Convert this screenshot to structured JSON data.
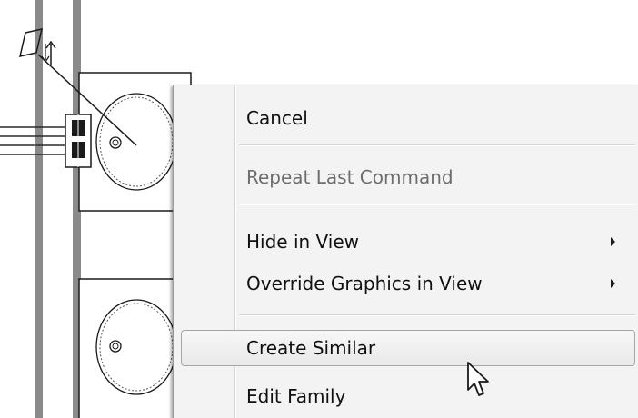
{
  "context_menu": {
    "items": [
      {
        "label": "Cancel",
        "enabled": true
      },
      {
        "label": "Repeat Last Command",
        "enabled": false
      },
      {
        "label": "Hide in View",
        "enabled": true,
        "submenu": true
      },
      {
        "label": "Override Graphics in View",
        "enabled": true,
        "submenu": true
      },
      {
        "label": "Create Similar",
        "enabled": true,
        "highlighted": true
      },
      {
        "label": "Edit Family",
        "enabled": true
      }
    ]
  },
  "icons": {
    "submenu_arrow": "chevron-right-icon",
    "cursor": "mouse-pointer-icon",
    "flip": "flip-arrows-icon"
  },
  "colors": {
    "menu_background": "#f3f3f3",
    "highlight_border": "#a6a6a6",
    "disabled_text": "#6d6d6d",
    "drawing_wall": "#8a8a8a"
  }
}
